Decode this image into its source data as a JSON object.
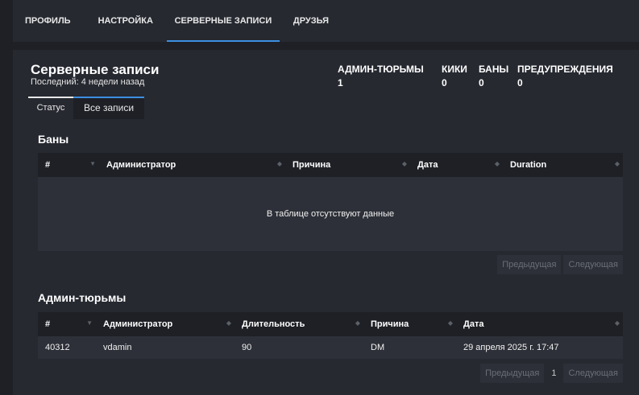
{
  "topnav": {
    "tabs": [
      "ПРОФИЛЬ",
      "НАСТРОЙКА",
      "СЕРВЕРНЫЕ ЗАПИСИ",
      "ДРУЗЬЯ"
    ]
  },
  "header": {
    "title": "Серверные записи",
    "subtitle": "Последний: 4 недели назад"
  },
  "stats": [
    {
      "label": "АДМИН-ТЮРЬМЫ",
      "value": "1"
    },
    {
      "label": "КИКИ",
      "value": "0"
    },
    {
      "label": "БАНЫ",
      "value": "0"
    },
    {
      "label": "ПРЕДУПРЕЖДЕНИЯ",
      "value": "0"
    }
  ],
  "subtabs": [
    "Статус",
    "Все записи"
  ],
  "bans": {
    "title": "Баны",
    "columns": [
      "#",
      "Администратор",
      "Причина",
      "Дата",
      "Duration"
    ],
    "empty": "В таблице отсутствуют данные",
    "pager": {
      "prev": "Предыдущая",
      "next": "Следующая"
    }
  },
  "jails": {
    "title": "Админ-тюрьмы",
    "columns": [
      "#",
      "Администратор",
      "Длительность",
      "Причина",
      "Дата"
    ],
    "rows": [
      [
        "40312",
        "vdamin",
        "90",
        "DM",
        "29 апреля 2025 г. 17:47"
      ]
    ],
    "pager": {
      "prev": "Предыдущая",
      "page": "1",
      "next": "Следующая"
    }
  },
  "icons": {
    "sort": "sort-icon"
  }
}
